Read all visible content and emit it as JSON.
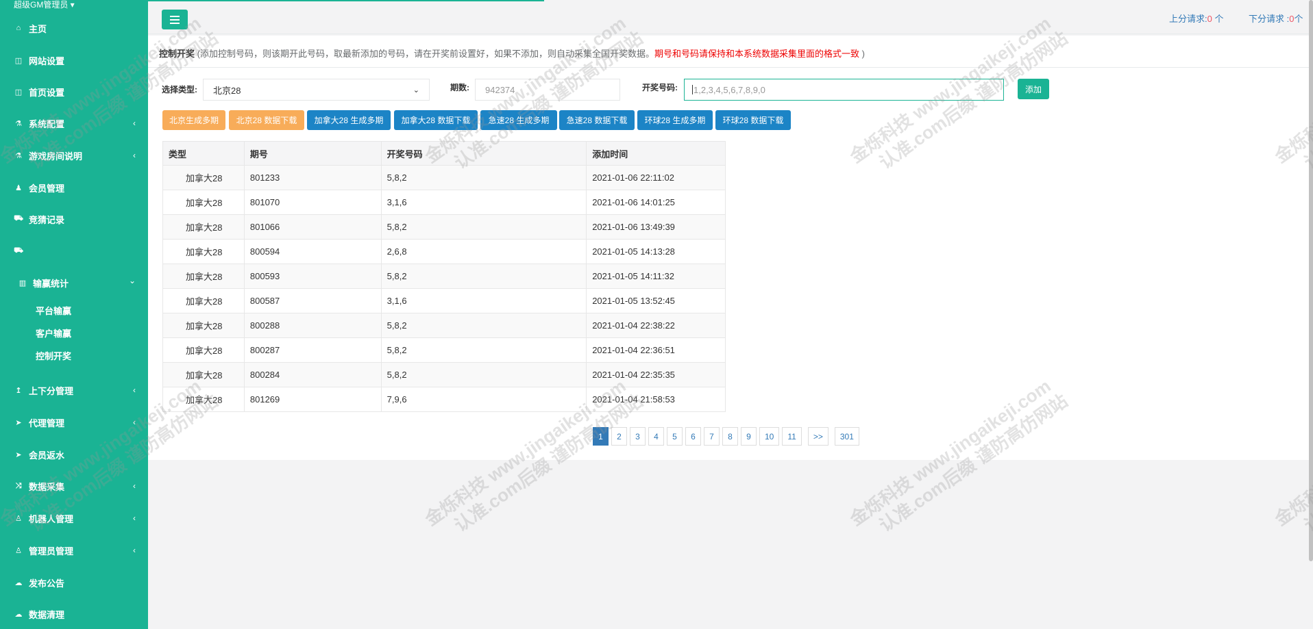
{
  "user": {
    "name": "超级GM管理员"
  },
  "sidebar": {
    "items": [
      {
        "label": "主页",
        "icon": "home-icon",
        "glyph": "⌂",
        "arrow": ""
      },
      {
        "label": "网站设置",
        "icon": "columns-icon",
        "glyph": "◫",
        "arrow": ""
      },
      {
        "label": "首页设置",
        "icon": "columns-icon",
        "glyph": "◫",
        "arrow": ""
      },
      {
        "label": "系统配置",
        "icon": "flask-icon",
        "glyph": "⚗",
        "arrow": "‹"
      },
      {
        "label": "游戏房间说明",
        "icon": "flask-icon",
        "glyph": "⚗",
        "arrow": "‹"
      },
      {
        "label": "会员管理",
        "icon": "user-icon",
        "glyph": "♟",
        "arrow": ""
      },
      {
        "label": "竞猜记录",
        "icon": "car-icon",
        "glyph": "⛟",
        "arrow": ""
      },
      {
        "label": "",
        "icon": "car-icon",
        "glyph": "⛟",
        "arrow": ""
      },
      {
        "label": "输赢统计",
        "icon": "bar-chart-icon",
        "glyph": "▥",
        "arrow": "⌄"
      },
      {
        "label": "上下分管理",
        "icon": "level-up-icon",
        "glyph": "↥",
        "arrow": "‹"
      },
      {
        "label": "代理管理",
        "icon": "paper-plane-icon",
        "glyph": "➤",
        "arrow": "‹"
      },
      {
        "label": "会员返水",
        "icon": "paper-plane-icon",
        "glyph": "➤",
        "arrow": ""
      },
      {
        "label": "数据采集",
        "icon": "random-icon",
        "glyph": "⤨",
        "arrow": "‹"
      },
      {
        "label": "机器人管理",
        "icon": "male-icon",
        "glyph": "♙",
        "arrow": "‹"
      },
      {
        "label": "管理员管理",
        "icon": "male-icon",
        "glyph": "♙",
        "arrow": "‹"
      },
      {
        "label": "发布公告",
        "icon": "comment-icon",
        "glyph": "☁",
        "arrow": ""
      },
      {
        "label": "数据清理",
        "icon": "comment-icon",
        "glyph": "☁",
        "arrow": ""
      }
    ],
    "subitems": [
      {
        "label": "平台输赢"
      },
      {
        "label": "客户输赢"
      },
      {
        "label": "控制开奖"
      }
    ]
  },
  "topbar": {
    "up_label": "上分请求:",
    "up_count": "0",
    "up_unit": " 个",
    "down_label": "下分请求 :",
    "down_count": "0",
    "down_unit": "个"
  },
  "panel": {
    "title": "控制开奖",
    "hint": " (添加控制号码，则该期开此号码，取最新添加的号码，请在开奖前设置好，如果不添加，则自动采集全国开奖数据。",
    "warn": "期号和号码请保持和本系统数据采集里面的格式一致",
    "close": " )"
  },
  "form": {
    "type_label": "选择类型:",
    "type_value": "北京28",
    "period_label": "期数:",
    "period_value": "942374",
    "number_label": "开奖号码:",
    "number_placeholder": "1,2,3,4,5,6,7,8,9,0",
    "add_label": "添加"
  },
  "buttons": [
    {
      "label": "北京生成多期",
      "color": "#f8ac59"
    },
    {
      "label": "北京28 数据下载",
      "color": "#f8ac59"
    },
    {
      "label": "加拿大28 生成多期",
      "color": "#1c84c6"
    },
    {
      "label": "加拿大28 数据下载",
      "color": "#1c84c6"
    },
    {
      "label": "急速28 生成多期",
      "color": "#1c84c6"
    },
    {
      "label": "急速28 数据下载",
      "color": "#1c84c6"
    },
    {
      "label": "环球28 生成多期",
      "color": "#1c84c6"
    },
    {
      "label": "环球28 数据下载",
      "color": "#1c84c6"
    }
  ],
  "table": {
    "headers": [
      "类型",
      "期号",
      "开奖号码",
      "添加时间"
    ],
    "rows": [
      [
        "加拿大28",
        "801233",
        "5,8,2",
        "2021-01-06 22:11:02"
      ],
      [
        "加拿大28",
        "801070",
        "3,1,6",
        "2021-01-06 14:01:25"
      ],
      [
        "加拿大28",
        "801066",
        "5,8,2",
        "2021-01-06 13:49:39"
      ],
      [
        "加拿大28",
        "800594",
        "2,6,8",
        "2021-01-05 14:13:28"
      ],
      [
        "加拿大28",
        "800593",
        "5,8,2",
        "2021-01-05 14:11:32"
      ],
      [
        "加拿大28",
        "800587",
        "3,1,6",
        "2021-01-05 13:52:45"
      ],
      [
        "加拿大28",
        "800288",
        "5,8,2",
        "2021-01-04 22:38:22"
      ],
      [
        "加拿大28",
        "800287",
        "5,8,2",
        "2021-01-04 22:36:51"
      ],
      [
        "加拿大28",
        "800284",
        "5,8,2",
        "2021-01-04 22:35:35"
      ],
      [
        "加拿大28",
        "801269",
        "7,9,6",
        "2021-01-04 21:58:53"
      ]
    ]
  },
  "pagination": {
    "pages": [
      "1",
      "2",
      "3",
      "4",
      "5",
      "6",
      "7",
      "8",
      "9",
      "10",
      "11"
    ],
    "active": "1",
    "next": ">>",
    "last": "301"
  },
  "watermark": {
    "line1": "金烁科技 www.jingaikeji.com",
    "line2": "认准.com后缀 谨防高仿网站"
  },
  "colors": {
    "brand": "#1ab394",
    "primary": "#1c84c6",
    "warning": "#f8ac59",
    "danger": "#ed5565",
    "link": "#337ab7"
  }
}
